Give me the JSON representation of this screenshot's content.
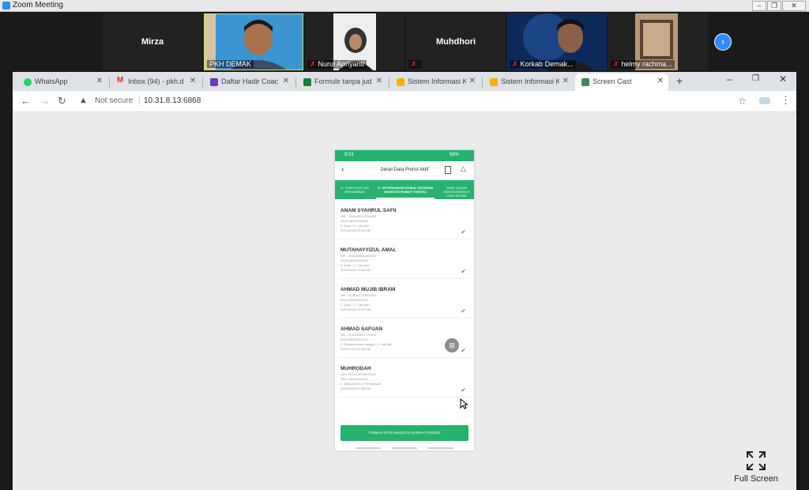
{
  "zoom": {
    "window_title": "Zoom Meeting",
    "participants": [
      {
        "name": "Mirza",
        "label": ""
      },
      {
        "name": "",
        "label": "PKH DEMAK"
      },
      {
        "name": "",
        "label": "Nurul Apriyanti"
      },
      {
        "name": "Muhdhori",
        "label": ""
      },
      {
        "name": "",
        "label": "Korkab Demak..."
      },
      {
        "name": "",
        "label": "helmy rachma..."
      }
    ],
    "next_icon": "chevron-right-icon"
  },
  "browser": {
    "tabs": [
      {
        "label": "WhatsApp",
        "icon_color": "#25d366",
        "active": false
      },
      {
        "label": "Inbox (94) - pkh.d",
        "icon_color": "#d93025",
        "active": false
      },
      {
        "label": "Daftar Hadir Coac",
        "icon_color": "#673ab7",
        "active": false
      },
      {
        "label": "Formulir tanpa jud",
        "icon_color": "#188038",
        "active": false
      },
      {
        "label": "Sistem Informasi K",
        "icon_color": "#f4b400",
        "active": false
      },
      {
        "label": "Sistem Informasi K",
        "icon_color": "#f4b400",
        "active": false
      },
      {
        "label": "Screen Cast",
        "icon_color": "#3c8a5c",
        "active": true
      }
    ],
    "new_tab": "+",
    "not_secure": "Not secure",
    "url": "10.31.8.13:6868"
  },
  "phone": {
    "status_time": "9:51",
    "status_battery": "58%",
    "title": "Detail Data Prelist Aktif",
    "tabs": [
      "III. IDENTITAS DAN PERUMAHAN",
      "IV. KETERANGAN SOSIAL EKONOMI ANGGOTA RUMAH TANGGA",
      "ANAK DALAM TANGGUNGAN DI LUAR RUMAH"
    ],
    "members": [
      {
        "name": "ANAM SYAHRUL SAFII",
        "nik": "NIK : 3321160012250002",
        "kk": "3321198000000402",
        "info": "3. Anak / 1. Laki-laki",
        "date": "22/04/2020 09:56 AM"
      },
      {
        "name": "MUTAHAYYIZUL AMAL",
        "nik": "NIK : 3321160030300003",
        "kk": "3321198000000402",
        "info": "3. Anak / 1. Laki-laki",
        "date": "22/04/2020 09:56 AM"
      },
      {
        "name": "AHMAD MUJIB IBRAM",
        "nik": "NIK : 3321161712000001",
        "kk": "3321198000000402",
        "info": "3. Anak / 1. Laki-laki",
        "date": "22/04/2020 09:57 AM"
      },
      {
        "name": "AHMAD SAFUAN",
        "nik": "NIK : 3321160807170003",
        "kk": "3321198000000401",
        "info": "1. Kepala rumah tangga / 1. Laki-laki",
        "date": "22/04/2020 09:56 AM"
      },
      {
        "name": "MUHRODAH",
        "nik": "NIK : 3321120035020004",
        "kk": "3321198000000401",
        "info": "2. Istri/suami / 2. Perempuan",
        "date": "22/04/2020 09:56 AM"
      }
    ],
    "add_button": "TAMBAH DATA ANGGOTA RUMAH TANGGA"
  },
  "fullscreen_label": "Full Screen"
}
